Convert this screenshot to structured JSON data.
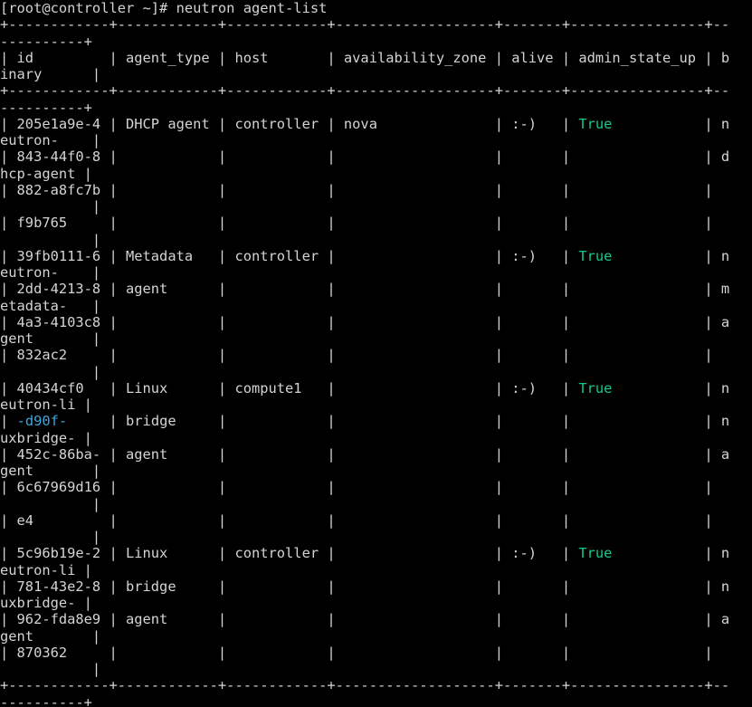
{
  "terminal": {
    "colors": {
      "background": "#000000",
      "foreground": "#d4d4d4",
      "green": "#16c98a",
      "blue": "#3ba6dd"
    },
    "lines": [
      [
        {
          "t": "[root@controller ~]# neutron agent-list"
        }
      ],
      [
        {
          "t": "+------------+------------+------------+-------------------+-------+----------------+--"
        }
      ],
      [
        {
          "t": "----------+"
        }
      ],
      [
        {
          "t": "| id         | agent_type | host       | availability_zone | alive | admin_state_up | b"
        }
      ],
      [
        {
          "t": "inary      |"
        }
      ],
      [
        {
          "t": "+------------+------------+------------+-------------------+-------+----------------+--"
        }
      ],
      [
        {
          "t": "----------+"
        }
      ],
      [
        {
          "t": "| 205e1a9e-4 | DHCP agent | controller | nova              | :-)   | "
        },
        {
          "t": "True",
          "c": "green"
        },
        {
          "t": "           | n"
        }
      ],
      [
        {
          "t": "eutron-    |"
        }
      ],
      [
        {
          "t": "| 843-44f0-8 |            |            |                   |       |                | d"
        }
      ],
      [
        {
          "t": "hcp-agent |"
        }
      ],
      [
        {
          "t": "| 882-a8fc7b |            |            |                   |       |                |"
        }
      ],
      [
        {
          "t": "           |"
        }
      ],
      [
        {
          "t": "| f9b765     |            |            |                   |       |                |"
        }
      ],
      [
        {
          "t": "           |"
        }
      ],
      [
        {
          "t": "| 39fb0111-6 | Metadata   | controller |                   | :-)   | "
        },
        {
          "t": "True",
          "c": "green"
        },
        {
          "t": "           | n"
        }
      ],
      [
        {
          "t": "eutron-    |"
        }
      ],
      [
        {
          "t": "| 2dd-4213-8 | agent      |            |                   |       |                | m"
        }
      ],
      [
        {
          "t": "etadata-   |"
        }
      ],
      [
        {
          "t": "| 4a3-4103c8 |            |            |                   |       |                | a"
        }
      ],
      [
        {
          "t": "gent       |"
        }
      ],
      [
        {
          "t": "| 832ac2     |            |            |                   |       |                |"
        }
      ],
      [
        {
          "t": "           |"
        }
      ],
      [
        {
          "t": "| 40434cf0   | Linux      | compute1   |                   | :-)   | "
        },
        {
          "t": "True",
          "c": "green"
        },
        {
          "t": "           | n"
        }
      ],
      [
        {
          "t": "eutron-li |"
        }
      ],
      [
        {
          "t": "| "
        },
        {
          "t": "-d90f-",
          "c": "blue"
        },
        {
          "t": "     | bridge     |            |                   |       |                | n"
        }
      ],
      [
        {
          "t": "uxbridge- |"
        }
      ],
      [
        {
          "t": "| 452c-86ba- | agent      |            |                   |       |                | a"
        }
      ],
      [
        {
          "t": "gent       |"
        }
      ],
      [
        {
          "t": "| 6c67969d16 |            |            |                   |       |                |"
        }
      ],
      [
        {
          "t": "           |"
        }
      ],
      [
        {
          "t": "| e4         |            |            |                   |       |                |"
        }
      ],
      [
        {
          "t": "           |"
        }
      ],
      [
        {
          "t": "| 5c96b19e-2 | Linux      | controller |                   | :-)   | "
        },
        {
          "t": "True",
          "c": "green"
        },
        {
          "t": "           | n"
        }
      ],
      [
        {
          "t": "eutron-li |"
        }
      ],
      [
        {
          "t": "| 781-43e2-8 | bridge     |            |                   |       |                | n"
        }
      ],
      [
        {
          "t": "uxbridge- |"
        }
      ],
      [
        {
          "t": "| 962-fda8e9 | agent      |            |                   |       |                | a"
        }
      ],
      [
        {
          "t": "gent       |"
        }
      ],
      [
        {
          "t": "| 870362     |            |            |                   |       |                |"
        }
      ],
      [
        {
          "t": "           |"
        }
      ],
      [
        {
          "t": "+------------+------------+------------+-------------------+-------+----------------+--"
        }
      ],
      [
        {
          "t": "----------+"
        }
      ]
    ]
  }
}
